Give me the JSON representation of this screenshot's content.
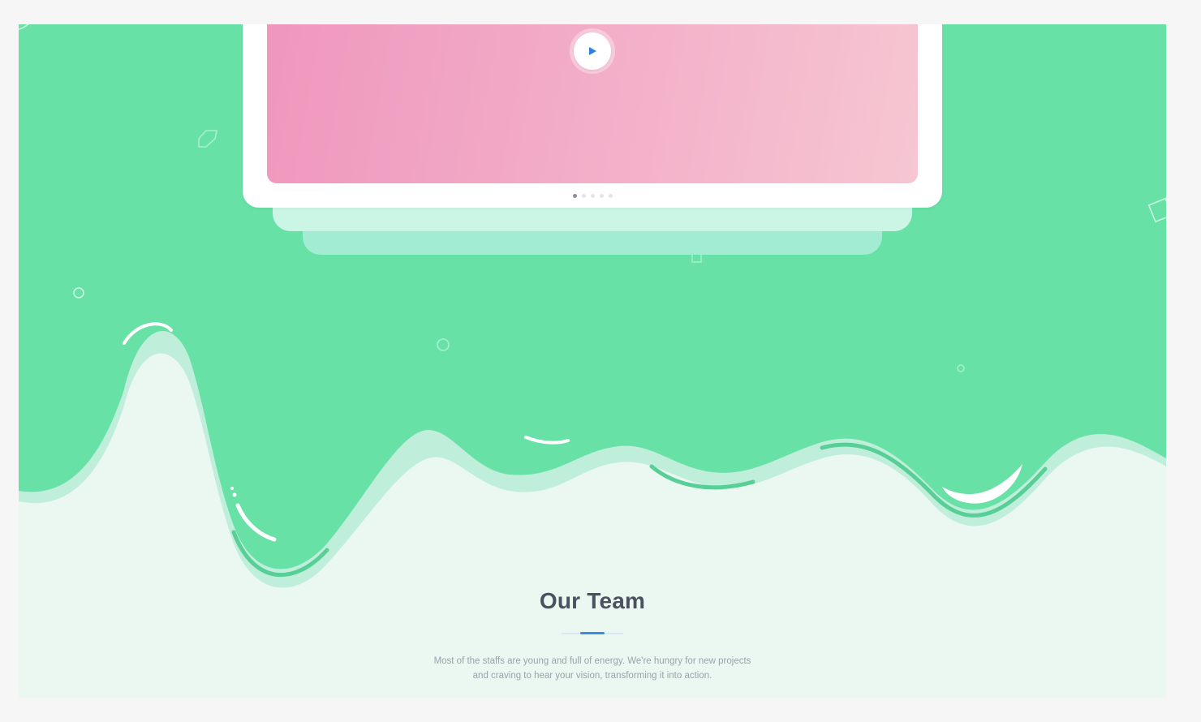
{
  "hero": {
    "background_color": "#67e1a6",
    "screen_gradient": [
      "#ef97bd",
      "#f6c6d2"
    ],
    "play_icon": "play-icon",
    "carousel": {
      "total": 5,
      "active": 1
    }
  },
  "team": {
    "title": "Our Team",
    "accent_color": "#3a8de0",
    "description": {
      "line1": "Most of the staffs are young and full of energy. We're hungry for new projects",
      "line2": "and craving to hear your vision, transforming it into action."
    }
  }
}
